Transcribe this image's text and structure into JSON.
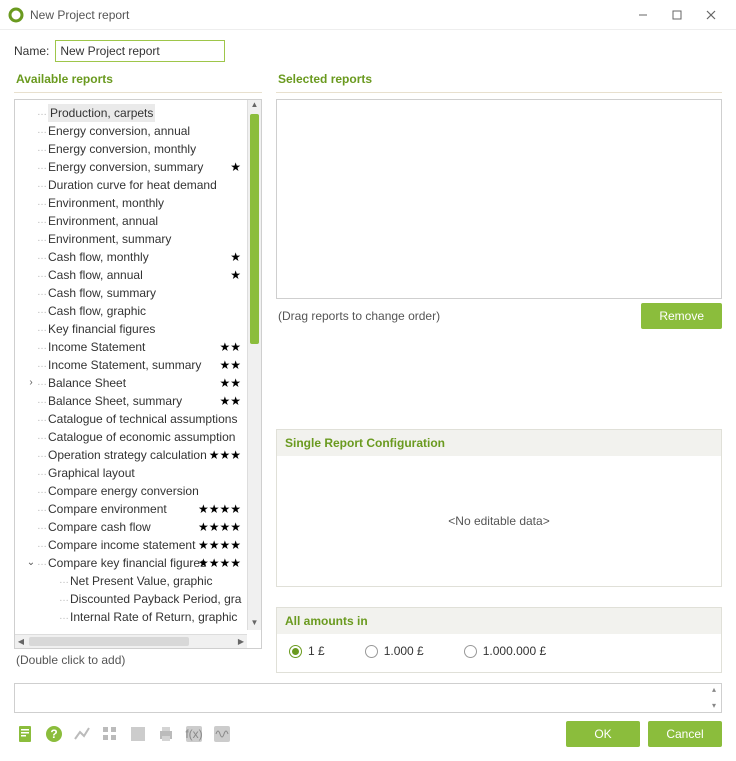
{
  "window": {
    "title": "New Project report"
  },
  "name": {
    "label": "Name:",
    "value": "New Project report"
  },
  "available": {
    "title": "Available reports",
    "hint": "(Double click to add)",
    "items": [
      {
        "label": "Production, carpets",
        "stars": 0,
        "selected": true,
        "exp": "",
        "indent": 0
      },
      {
        "label": "Energy conversion, annual",
        "stars": 0,
        "exp": "",
        "indent": 0
      },
      {
        "label": "Energy conversion, monthly",
        "stars": 0,
        "exp": "",
        "indent": 0
      },
      {
        "label": "Energy conversion, summary",
        "stars": 1,
        "exp": "",
        "indent": 0
      },
      {
        "label": "Duration curve for heat demand",
        "stars": 0,
        "exp": "",
        "indent": 0
      },
      {
        "label": "Environment, monthly",
        "stars": 0,
        "exp": "",
        "indent": 0
      },
      {
        "label": "Environment, annual",
        "stars": 0,
        "exp": "",
        "indent": 0
      },
      {
        "label": "Environment, summary",
        "stars": 0,
        "exp": "",
        "indent": 0
      },
      {
        "label": "Cash flow, monthly",
        "stars": 1,
        "exp": "",
        "indent": 0
      },
      {
        "label": "Cash flow, annual",
        "stars": 1,
        "exp": "",
        "indent": 0
      },
      {
        "label": "Cash flow, summary",
        "stars": 0,
        "exp": "",
        "indent": 0
      },
      {
        "label": "Cash flow, graphic",
        "stars": 0,
        "exp": "",
        "indent": 0
      },
      {
        "label": "Key financial figures",
        "stars": 0,
        "exp": "",
        "indent": 0
      },
      {
        "label": "Income Statement",
        "stars": 2,
        "exp": "",
        "indent": 0
      },
      {
        "label": "Income Statement, summary",
        "stars": 2,
        "exp": "",
        "indent": 0
      },
      {
        "label": "Balance Sheet",
        "stars": 2,
        "exp": ">",
        "indent": 0
      },
      {
        "label": "Balance Sheet, summary",
        "stars": 2,
        "exp": "",
        "indent": 0
      },
      {
        "label": "Catalogue of technical assumptions",
        "stars": 0,
        "exp": "",
        "indent": 0
      },
      {
        "label": "Catalogue of economic assumption",
        "stars": 0,
        "exp": "",
        "indent": 0
      },
      {
        "label": "Operation strategy calculation",
        "stars": 3,
        "exp": "",
        "indent": 0
      },
      {
        "label": "Graphical layout",
        "stars": 0,
        "exp": "",
        "indent": 0
      },
      {
        "label": "Compare energy conversion",
        "stars": 0,
        "exp": "",
        "indent": 0
      },
      {
        "label": "Compare environment",
        "stars": 4,
        "exp": "",
        "indent": 0
      },
      {
        "label": "Compare cash flow",
        "stars": 4,
        "exp": "",
        "indent": 0
      },
      {
        "label": "Compare income statement",
        "stars": 4,
        "exp": "",
        "indent": 0
      },
      {
        "label": "Compare key financial figures",
        "stars": 4,
        "exp": "v",
        "indent": 0
      },
      {
        "label": "Net Present Value, graphic",
        "stars": 0,
        "exp": "",
        "indent": 1
      },
      {
        "label": "Discounted Payback Period, gra",
        "stars": 0,
        "exp": "",
        "indent": 1
      },
      {
        "label": "Internal Rate of Return, graphic",
        "stars": 0,
        "exp": "",
        "indent": 1
      }
    ]
  },
  "selected": {
    "title": "Selected reports",
    "drag_hint": "(Drag reports to change order)",
    "remove_label": "Remove"
  },
  "single": {
    "title": "Single Report Configuration",
    "noedit": "<No editable data>"
  },
  "amounts": {
    "title": "All amounts in",
    "options": [
      {
        "label": "1 £",
        "selected": true
      },
      {
        "label": "1.000 £",
        "selected": false
      },
      {
        "label": "1.000.000 £",
        "selected": false
      }
    ]
  },
  "buttons": {
    "ok": "OK",
    "cancel": "Cancel"
  }
}
